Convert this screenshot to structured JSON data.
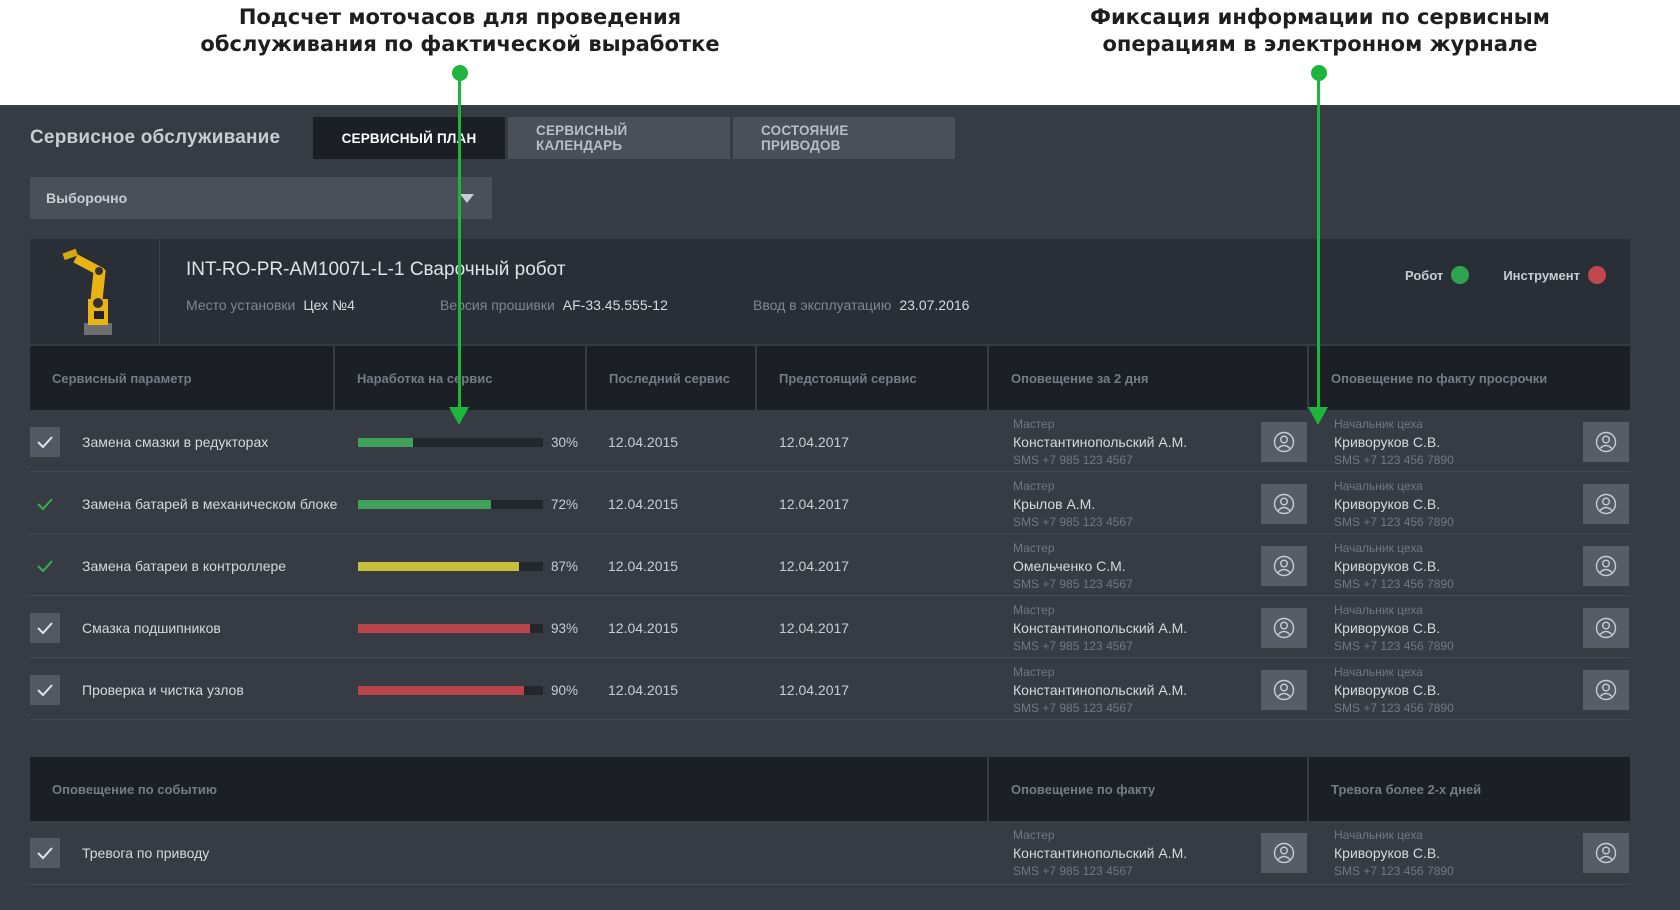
{
  "annotations": {
    "left_title": "Подсчет моточасов для проведения\nобслуживания по фактической выработке",
    "right_title": "Фиксация информации по сервисным\nоперациям в электронном журнале",
    "accent_color": "#1db53b"
  },
  "header": {
    "title": "Сервисное обслуживание",
    "tabs": [
      {
        "label": "СЕРВИСНЫЙ ПЛАН",
        "active": true
      },
      {
        "label": "СЕРВИСНЫЙ КАЛЕНДАРЬ",
        "active": false
      },
      {
        "label": "СОСТОЯНИЕ ПРИВОДОВ",
        "active": false
      }
    ]
  },
  "filter": {
    "selected": "Выборочно",
    "icon": "chevron-down-icon"
  },
  "device": {
    "name": "INT-RO-PR-AM1007L-L-1 Сварочный робот",
    "location_label": "Место установки",
    "location_value": "Цех №4",
    "firmware_label": "Версия прошивки",
    "firmware_value": "AF-33.45.555-12",
    "commission_label": "Ввод в эксплуатацию",
    "commission_value": "23.07.2016",
    "legend": [
      {
        "label": "Робот",
        "color": "#2fa44f"
      },
      {
        "label": "Инструмент",
        "color": "#c0474d"
      }
    ]
  },
  "service_table": {
    "columns": [
      "Сервисный параметр",
      "Наработка на сервис",
      "Последний сервис",
      "Предстоящий сервис",
      "Оповещение за 2 дня",
      "Оповещение по факту просрочки"
    ],
    "rows": [
      {
        "name": "Замена смазки в редукторах",
        "checked_box": true,
        "progress": 30,
        "progress_label": "30%",
        "bar_color": "#3fa15a",
        "last": "12.04.2015",
        "next": "12.04.2017",
        "n1_role": "Мастер",
        "n1_name": "Константинопольский А.М.",
        "n1_sms": "SMS +7 985 123 4567",
        "n2_role": "Начальник цеха",
        "n2_name": "Криворуков С.В.",
        "n2_sms": "SMS +7 123 456 7890"
      },
      {
        "name": "Замена батарей в механическом блоке",
        "checked_box": false,
        "progress": 72,
        "progress_label": "72%",
        "bar_color": "#3fa15a",
        "last": "12.04.2015",
        "next": "12.04.2017",
        "n1_role": "Мастер",
        "n1_name": "Крылов А.М.",
        "n1_sms": "SMS +7 985 123 4567",
        "n2_role": "Начальник цеха",
        "n2_name": "Криворуков С.В.",
        "n2_sms": "SMS +7 123 456 7890"
      },
      {
        "name": "Замена батареи в контроллере",
        "checked_box": false,
        "progress": 87,
        "progress_label": "87%",
        "bar_color": "#c9bf3c",
        "last": "12.04.2015",
        "next": "12.04.2017",
        "n1_role": "Мастер",
        "n1_name": "Омельченко С.М.",
        "n1_sms": "SMS +7 985 123 4567",
        "n2_role": "Начальник цеха",
        "n2_name": "Криворуков С.В.",
        "n2_sms": "SMS +7 123 456 7890"
      },
      {
        "name": "Смазка подшипников",
        "checked_box": true,
        "progress": 93,
        "progress_label": "93%",
        "bar_color": "#b9454a",
        "last": "12.04.2015",
        "next": "12.04.2017",
        "n1_role": "Мастер",
        "n1_name": "Константинопольский А.М.",
        "n1_sms": "SMS +7 985 123 4567",
        "n2_role": "Начальник цеха",
        "n2_name": "Криворуков С.В.",
        "n2_sms": "SMS +7 123 456 7890"
      },
      {
        "name": "Проверка и чистка узлов",
        "checked_box": true,
        "progress": 90,
        "progress_label": "90%",
        "bar_color": "#b9454a",
        "last": "12.04.2015",
        "next": "12.04.2017",
        "n1_role": "Мастер",
        "n1_name": "Константинопольский А.М.",
        "n1_sms": "SMS +7 985 123 4567",
        "n2_role": "Начальник цеха",
        "n2_name": "Криворуков С.В.",
        "n2_sms": "SMS +7 123 456 7890"
      }
    ]
  },
  "event_table": {
    "columns": [
      "Оповещение по событию",
      "Оповещение по факту",
      "Тревога более 2-х дней"
    ],
    "rows": [
      {
        "name": "Тревога по приводу",
        "checked_box": true,
        "n1_role": "Мастер",
        "n1_name": "Константинопольский А.М.",
        "n1_sms": "SMS +7 985 123 4567",
        "n2_role": "Начальник цеха",
        "n2_name": "Криворуков С.В.",
        "n2_sms": "SMS +7 123 456 7890"
      }
    ]
  },
  "colors": {
    "check_green": "#35b04f",
    "check_white": "#dfe2e7"
  }
}
